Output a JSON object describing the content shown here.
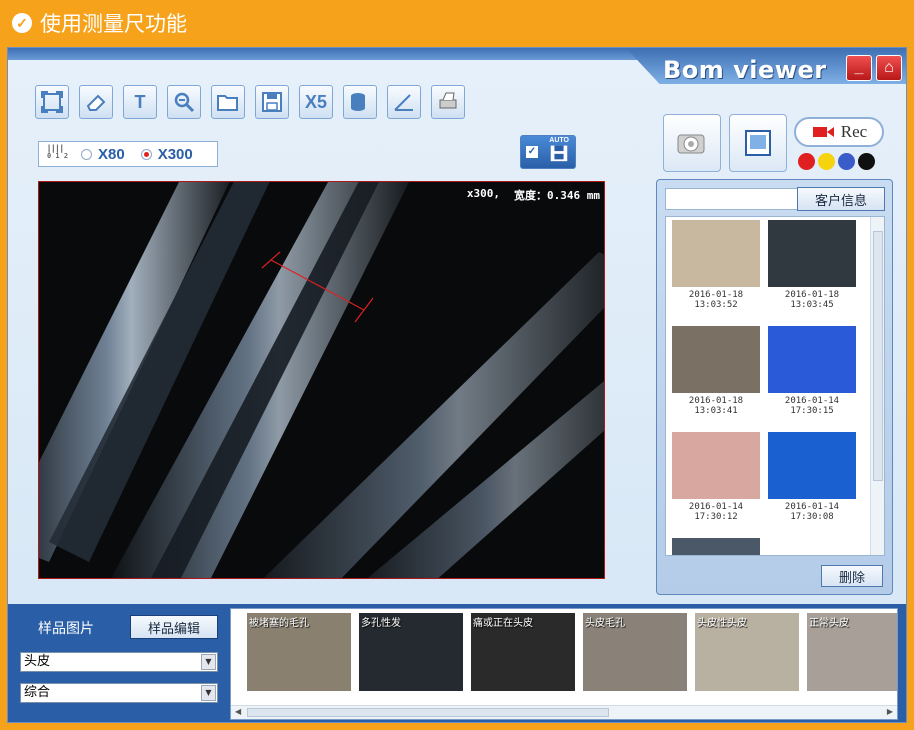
{
  "banner": {
    "title": "使用测量尺功能"
  },
  "app": {
    "brand": "Bom viewer"
  },
  "window_buttons": {
    "minimize": "_",
    "home": "⌂"
  },
  "toolbar": {
    "tools": [
      {
        "name": "fit-screen-icon",
        "glyph": ""
      },
      {
        "name": "eraser-icon",
        "glyph": ""
      },
      {
        "name": "text-icon",
        "glyph": "T"
      },
      {
        "name": "zoom-icon",
        "glyph": ""
      },
      {
        "name": "open-folder-icon",
        "glyph": ""
      },
      {
        "name": "save-icon",
        "glyph": ""
      },
      {
        "name": "x5-icon",
        "glyph": "X5"
      },
      {
        "name": "database-icon",
        "glyph": ""
      },
      {
        "name": "angle-icon",
        "glyph": ""
      },
      {
        "name": "print-icon",
        "glyph": ""
      }
    ]
  },
  "magnification": {
    "ruler": "0 1 2",
    "option1": "X80",
    "option2": "X300",
    "selected": "X300"
  },
  "autosave": {
    "label": "AUTO",
    "checked": true
  },
  "viewer": {
    "zoom": "x300,",
    "measure": "宽度：0.346 mm"
  },
  "capture": {
    "rec_label": "Rec"
  },
  "colors": {
    "red": "#e02020",
    "yellow": "#f5d40f",
    "blue": "#3a5cc8",
    "black": "#101010"
  },
  "client": {
    "button": "客户信息",
    "delete": "删除",
    "thumbnails": [
      {
        "date": "2016-01-18",
        "time": "13:03:52",
        "color": "#c8b8a0"
      },
      {
        "date": "2016-01-18",
        "time": "13:03:45",
        "color": "#303840"
      },
      {
        "date": "2016-01-18",
        "time": "13:03:41",
        "color": "#7a7064"
      },
      {
        "date": "2016-01-14",
        "time": "17:30:15",
        "color": "#2a5ad8"
      },
      {
        "date": "2016-01-14",
        "time": "17:30:12",
        "color": "#d8a8a0"
      },
      {
        "date": "2016-01-14",
        "time": "17:30:08",
        "color": "#1a60d0"
      },
      {
        "date": "",
        "time": "",
        "color": "#4a5868"
      }
    ]
  },
  "sample": {
    "label": "样品图片",
    "edit_button": "样品编辑",
    "select1": "头皮",
    "select2": "综合",
    "strip": [
      {
        "label": "被堵塞的毛孔",
        "color": "#8a8070"
      },
      {
        "label": "多孔性发",
        "color": "#252a30"
      },
      {
        "label": "痛或正在头皮",
        "color": "#2a2a2a"
      },
      {
        "label": "头皮毛孔",
        "color": "#8a8278"
      },
      {
        "label": "头皮性头皮",
        "color": "#b8b0a0"
      },
      {
        "label": "正常头皮",
        "color": "#a8a098"
      }
    ]
  }
}
